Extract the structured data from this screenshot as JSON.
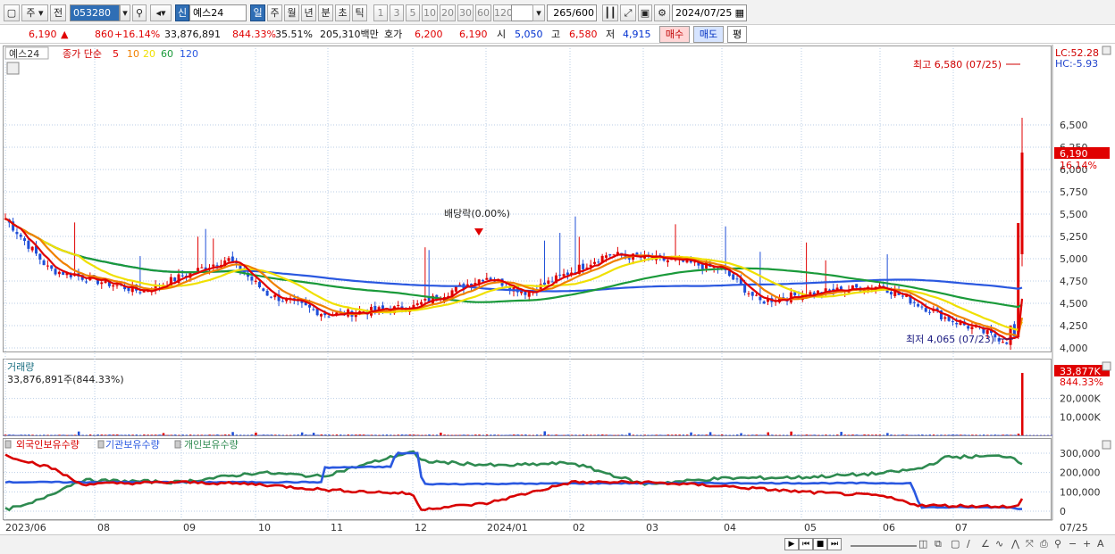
{
  "toolbar": {
    "period_type": "주",
    "prev_label": "전",
    "code": "053280",
    "badge": "신",
    "stock_name": "예스24",
    "period_buttons": [
      "일",
      "주",
      "월",
      "년",
      "분",
      "초",
      "틱"
    ],
    "interval_buttons": [
      "1",
      "3",
      "5",
      "10",
      "20",
      "30",
      "60",
      "120"
    ],
    "count": "265",
    "count_max": "/600",
    "date": "2024/07/25"
  },
  "quote": {
    "price": "6,190",
    "change_arrow": "▲",
    "change": "860",
    "change_pct": "+16.14%",
    "volume": "33,876,891",
    "volume_ratio": "844.33%",
    "turnover": "35.51%",
    "amount": "205,310백만",
    "hoga_label": "호가",
    "ask": "6,200",
    "bid": "6,190",
    "open_label": "시",
    "open": "5,050",
    "high_label": "고",
    "high": "6,580",
    "low_label": "저",
    "low": "4,915",
    "buy_label": "매수",
    "sell_label": "매도",
    "eval_label": "평"
  },
  "price_panel": {
    "legend_name": "예스24",
    "legend_type": "종가 단순",
    "ma_labels": [
      "5",
      "10",
      "20",
      "60",
      "120"
    ],
    "lc_label": "LC:52.28",
    "hc_label": "HC:-5.93",
    "current_price": "6,190",
    "current_pct": "16.14%",
    "high_note": "최고 6,580 (07/25)",
    "low_note": "최저 4,065 (07/23)",
    "dividend_note": "배당락(0.00%)",
    "y_ticks": [
      "6,500",
      "6,250",
      "6,000",
      "5,750",
      "5,500",
      "5,250",
      "5,000",
      "4,750",
      "4,500",
      "4,250",
      "4,000"
    ]
  },
  "volume_panel": {
    "title": "거래량",
    "summary": "33,876,891주(844.33%)",
    "badge_value": "33,877K",
    "badge_pct": "844.33%",
    "y_ticks": [
      "20,000K",
      "10,000K"
    ]
  },
  "holdings_panel": {
    "foreign_label": "외국인보유수량",
    "inst_label": "기관보유수량",
    "indiv_label": "개인보유수량",
    "y_ticks": [
      "300,000",
      "200,000",
      "100,000",
      "0"
    ]
  },
  "x_labels": [
    "2023/06",
    "08",
    "09",
    "10",
    "11",
    "12",
    "2024/01",
    "02",
    "03",
    "04",
    "05",
    "06",
    "07",
    "07/25"
  ],
  "colors": {
    "up": "#e00000",
    "down": "#1f4fd8",
    "ma5": "#e00000",
    "ma10": "#f08000",
    "ma20": "#f0e000",
    "ma60": "#1a9a3a",
    "ma120": "#2a58e0",
    "foreign": "#d80000",
    "inst": "#2a58e0",
    "indiv": "#2e8a50"
  },
  "chart_data": {
    "type": "candlestick",
    "price_range": [
      4000,
      6580
    ],
    "ohlc_waypoints": [
      {
        "date": "2023/06",
        "close": 5450
      },
      {
        "date": "2023/07",
        "close": 4880
      },
      {
        "date": "2023/08",
        "close": 4630
      },
      {
        "date": "2023/09",
        "close": 4830
      },
      {
        "date": "2023/09/end",
        "close": 5000
      },
      {
        "date": "2023/10",
        "close": 4600
      },
      {
        "date": "2023/11",
        "close": 4370
      },
      {
        "date": "2023/12",
        "close": 4460
      },
      {
        "date": "2024/01",
        "close": 4800
      },
      {
        "date": "2024/02",
        "close": 4620
      },
      {
        "date": "2024/02/mid",
        "close": 5050
      },
      {
        "date": "2024/03",
        "close": 4970
      },
      {
        "date": "2024/04",
        "close": 4880
      },
      {
        "date": "2024/04/end",
        "close": 4520
      },
      {
        "date": "2024/05",
        "close": 4600
      },
      {
        "date": "2024/06",
        "close": 4700
      },
      {
        "date": "2024/07",
        "close": 4330
      },
      {
        "date": "2024/07/23",
        "close": 4065
      },
      {
        "date": "2024/07/25",
        "close": 6190
      }
    ],
    "last_candle": {
      "date": "2024/07/25",
      "open": 5050,
      "high": 6580,
      "low": 4915,
      "close": 6190
    },
    "moving_averages": [
      {
        "name": "5",
        "color": "#e00000"
      },
      {
        "name": "10",
        "color": "#f08000"
      },
      {
        "name": "20",
        "color": "#f0e000"
      },
      {
        "name": "60",
        "color": "#1a9a3a"
      },
      {
        "name": "120",
        "color": "#2a58e0"
      }
    ],
    "volume_last": 33876891,
    "volume_range": [
      0,
      33877000
    ],
    "holdings_range": [
      0,
      300000
    ],
    "holdings_last": {
      "foreign": 60000,
      "inst": 10000,
      "indiv": 250000
    }
  }
}
